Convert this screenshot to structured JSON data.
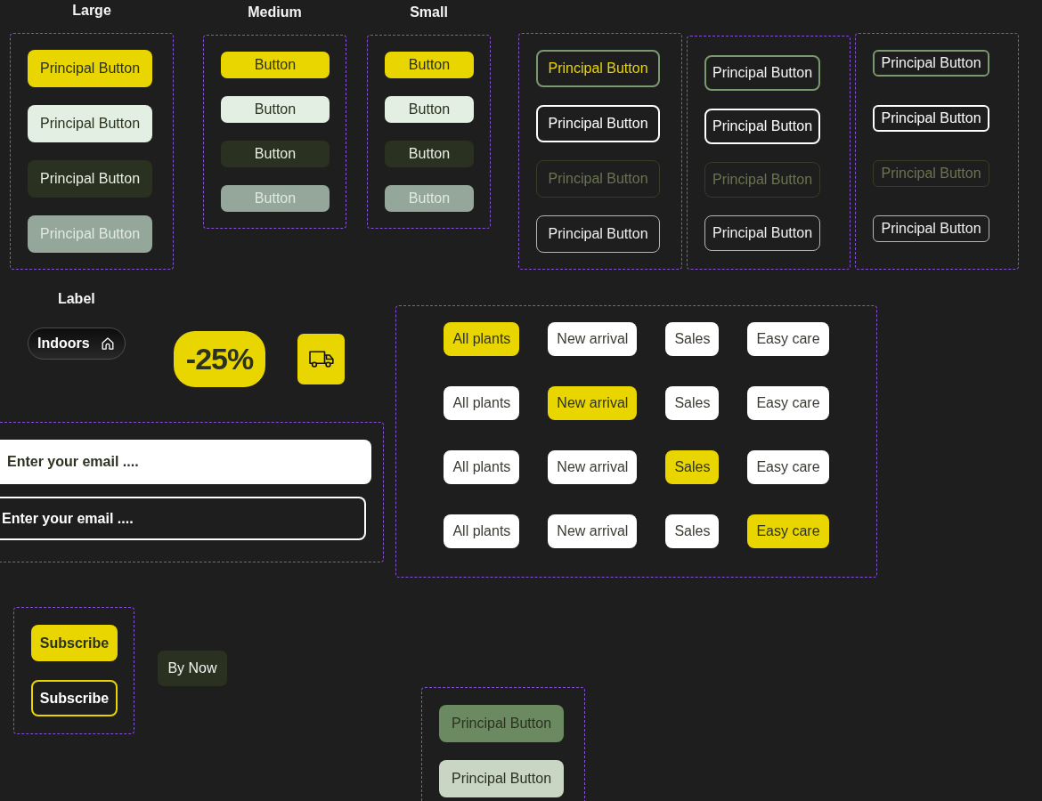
{
  "size_groups": [
    {
      "heading": "Large",
      "kind": "large",
      "buttons": [
        {
          "label": "Principal Button",
          "kind": "primary"
        },
        {
          "label": "Principal Button",
          "kind": "light"
        },
        {
          "label": "Principal Button",
          "kind": "dark"
        },
        {
          "label": "Principal Button",
          "kind": "disabled"
        }
      ]
    },
    {
      "heading": "Medium",
      "kind": "medium",
      "buttons": [
        {
          "label": "Button",
          "kind": "primary"
        },
        {
          "label": "Button",
          "kind": "light"
        },
        {
          "label": "Button",
          "kind": "dark"
        },
        {
          "label": "Button",
          "kind": "disabled"
        }
      ]
    },
    {
      "heading": "Small",
      "kind": "small",
      "buttons": [
        {
          "label": "Button",
          "kind": "primary"
        },
        {
          "label": "Button",
          "kind": "light"
        },
        {
          "label": "Button",
          "kind": "dark"
        },
        {
          "label": "Button",
          "kind": "disabled"
        }
      ]
    }
  ],
  "outline_groups": [
    {
      "kind": "large",
      "buttons": [
        {
          "label": "Principal Button",
          "kind": "active"
        },
        {
          "label": "Principal Button",
          "kind": "focus"
        },
        {
          "label": "Principal Button",
          "kind": "disabled"
        },
        {
          "label": "Principal Button",
          "kind": "default"
        }
      ]
    },
    {
      "kind": "medium",
      "buttons": [
        {
          "label": "Principal Button",
          "kind": "hover"
        },
        {
          "label": "Principal Button",
          "kind": "focus"
        },
        {
          "label": "Principal Button",
          "kind": "disabled"
        },
        {
          "label": "Principal Button",
          "kind": "default"
        }
      ]
    },
    {
      "kind": "small",
      "buttons": [
        {
          "label": "Principal Button",
          "kind": "hover"
        },
        {
          "label": "Principal Button",
          "kind": "focus"
        },
        {
          "label": "Principal Button",
          "kind": "disabled"
        },
        {
          "label": "Principal Button",
          "kind": "default"
        }
      ]
    }
  ],
  "label_section": {
    "heading": "Label",
    "chip": {
      "label": "Indoors"
    }
  },
  "discount_badge": "-25%",
  "email_fields": [
    {
      "placeholder": "Enter your email ....",
      "kind": "filled"
    },
    {
      "placeholder": "Enter your email ....",
      "kind": "outlined"
    }
  ],
  "filter_rows": [
    {
      "chips": [
        {
          "label": "All plants",
          "selected": true
        },
        {
          "label": "New arrival",
          "selected": false
        },
        {
          "label": "Sales",
          "selected": false
        },
        {
          "label": "Easy care",
          "selected": false
        }
      ]
    },
    {
      "chips": [
        {
          "label": "All plants",
          "selected": false
        },
        {
          "label": "New arrival",
          "selected": true
        },
        {
          "label": "Sales",
          "selected": false
        },
        {
          "label": "Easy care",
          "selected": false
        }
      ]
    },
    {
      "chips": [
        {
          "label": "All plants",
          "selected": false
        },
        {
          "label": "New arrival",
          "selected": false
        },
        {
          "label": "Sales",
          "selected": true
        },
        {
          "label": "Easy care",
          "selected": false
        }
      ]
    },
    {
      "chips": [
        {
          "label": "All plants",
          "selected": false
        },
        {
          "label": "New arrival",
          "selected": false
        },
        {
          "label": "Sales",
          "selected": false
        },
        {
          "label": "Easy care",
          "selected": true
        }
      ]
    }
  ],
  "subscribe_buttons": [
    {
      "label": "Subscribe",
      "kind": "filled"
    },
    {
      "label": "Subscribe",
      "kind": "outlined"
    }
  ],
  "buy_button": {
    "label": "By Now"
  },
  "green_buttons": [
    {
      "label": "Principal Button",
      "kind": "green"
    },
    {
      "label": "Principal Button",
      "kind": "pale"
    }
  ]
}
